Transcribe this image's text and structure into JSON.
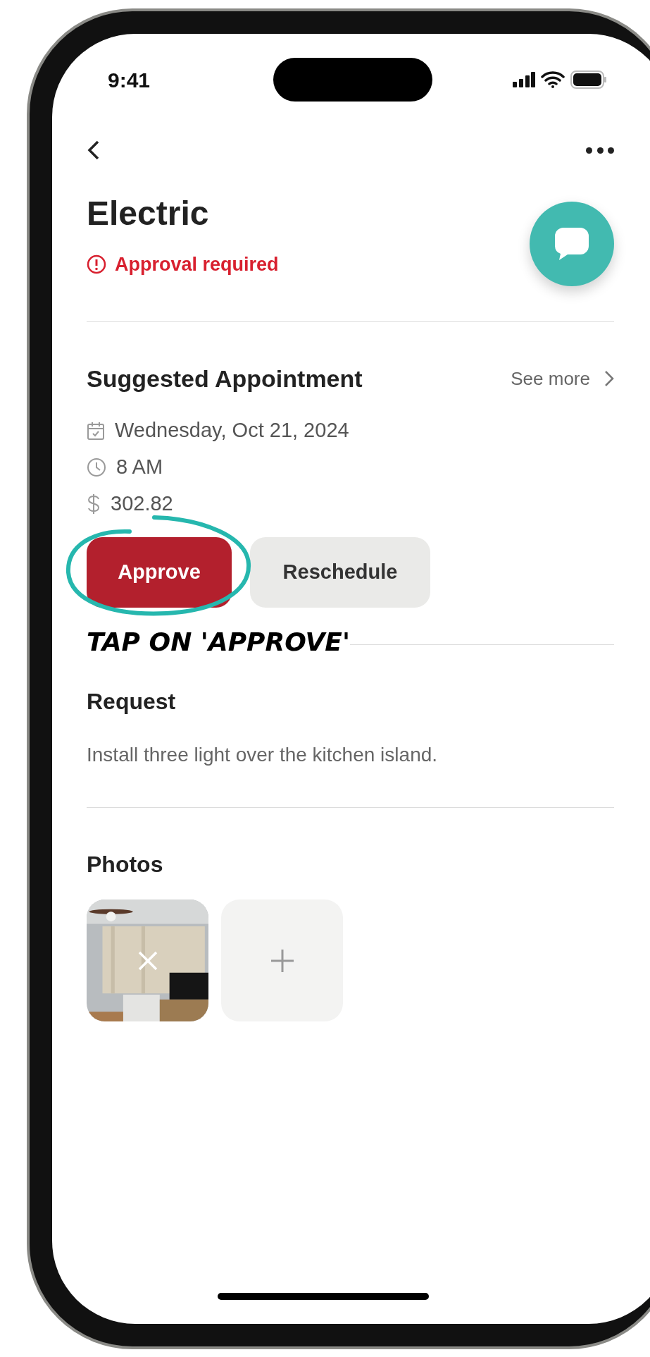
{
  "status_bar": {
    "time": "9:41"
  },
  "header": {
    "title": "Electric",
    "status": {
      "kind": "warning",
      "text": "Approval required"
    }
  },
  "appointment": {
    "title": "Suggested Appointment",
    "link": "See more",
    "details": [
      {
        "kind": "date",
        "text": "Wednesday, Oct 21, 2024"
      },
      {
        "kind": "time",
        "text": "8 AM"
      },
      {
        "kind": "price",
        "text": "302.82"
      }
    ],
    "buttons": [
      {
        "kind": "primary",
        "label": "Approve"
      },
      {
        "kind": "secondary",
        "label": "Reschedule"
      }
    ]
  },
  "annotation": {
    "text": "TAP ON 'APPROVE'"
  },
  "request": {
    "title": "Request",
    "text": "Install three light over the kitchen island."
  },
  "photos": {
    "title": "Photos",
    "items": [
      {
        "kind": "picture"
      },
      {
        "kind": "add"
      }
    ]
  }
}
